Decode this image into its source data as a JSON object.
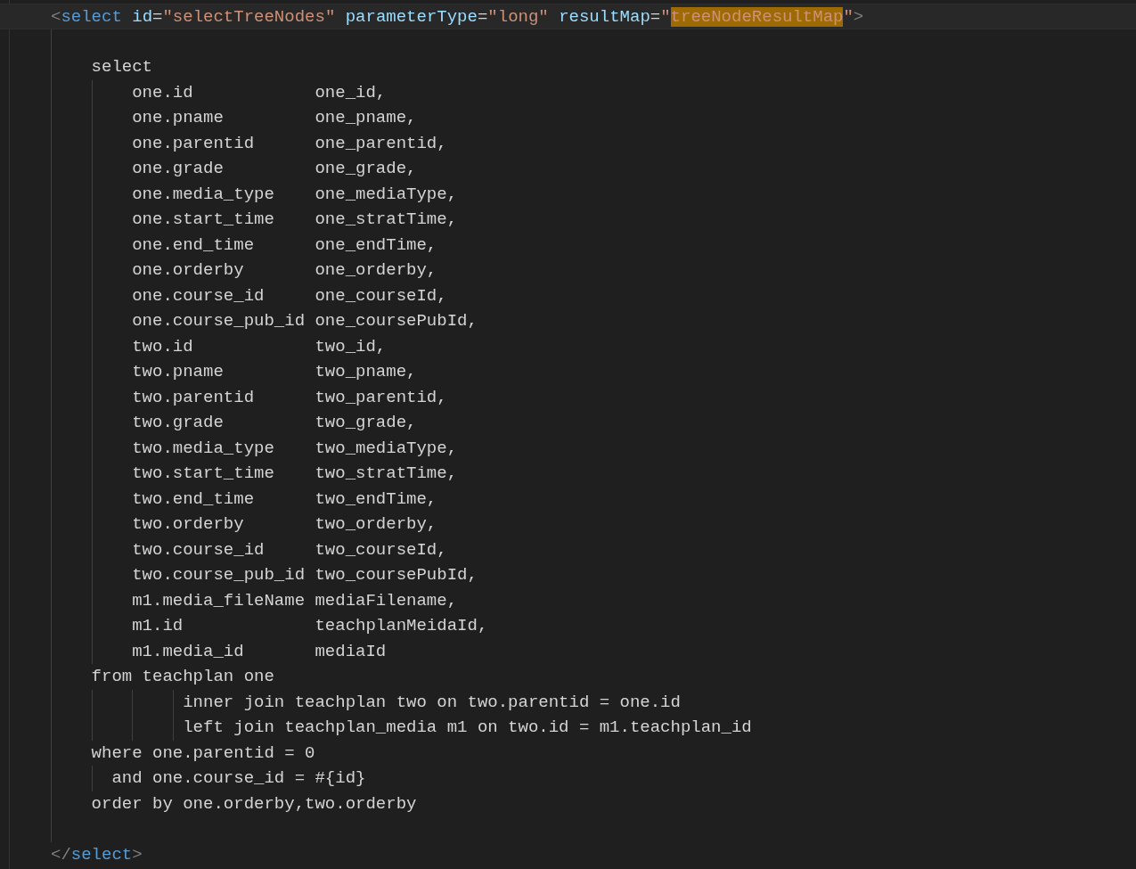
{
  "editor": {
    "lines": [
      {
        "kind": "code",
        "current": true,
        "tokens": [
          {
            "kind": "punct",
            "text": "    <"
          },
          {
            "kind": "tag",
            "text": "select"
          },
          {
            "kind": "attr",
            "text": " id"
          },
          {
            "kind": "plain",
            "text": "="
          },
          {
            "kind": "string",
            "text": "\"selectTreeNodes\""
          },
          {
            "kind": "attr",
            "text": " parameterType"
          },
          {
            "kind": "plain",
            "text": "="
          },
          {
            "kind": "string",
            "text": "\"long\""
          },
          {
            "kind": "attr",
            "text": " resultMap"
          },
          {
            "kind": "plain",
            "text": "="
          },
          {
            "kind": "string",
            "text": "\""
          },
          {
            "kind": "match",
            "text": "treeNodeResultMap"
          },
          {
            "kind": "string",
            "text": "\""
          },
          {
            "kind": "punct",
            "text": ">"
          }
        ]
      },
      {
        "kind": "blank",
        "current": false
      },
      {
        "kind": "code",
        "current": false,
        "tokens": [
          {
            "kind": "plain",
            "text": "        select"
          }
        ]
      },
      {
        "kind": "code",
        "current": false,
        "tokens": [
          {
            "kind": "plain",
            "text": "            one.id            one_id,"
          }
        ]
      },
      {
        "kind": "code",
        "current": false,
        "tokens": [
          {
            "kind": "plain",
            "text": "            one.pname         one_pname,"
          }
        ]
      },
      {
        "kind": "code",
        "current": false,
        "tokens": [
          {
            "kind": "plain",
            "text": "            one.parentid      one_parentid,"
          }
        ]
      },
      {
        "kind": "code",
        "current": false,
        "tokens": [
          {
            "kind": "plain",
            "text": "            one.grade         one_grade,"
          }
        ]
      },
      {
        "kind": "code",
        "current": false,
        "tokens": [
          {
            "kind": "plain",
            "text": "            one.media_type    one_mediaType,"
          }
        ]
      },
      {
        "kind": "code",
        "current": false,
        "tokens": [
          {
            "kind": "plain",
            "text": "            one.start_time    one_stratTime,"
          }
        ]
      },
      {
        "kind": "code",
        "current": false,
        "tokens": [
          {
            "kind": "plain",
            "text": "            one.end_time      one_endTime,"
          }
        ]
      },
      {
        "kind": "code",
        "current": false,
        "tokens": [
          {
            "kind": "plain",
            "text": "            one.orderby       one_orderby,"
          }
        ]
      },
      {
        "kind": "code",
        "current": false,
        "tokens": [
          {
            "kind": "plain",
            "text": "            one.course_id     one_courseId,"
          }
        ]
      },
      {
        "kind": "code",
        "current": false,
        "tokens": [
          {
            "kind": "plain",
            "text": "            one.course_pub_id one_coursePubId,"
          }
        ]
      },
      {
        "kind": "code",
        "current": false,
        "tokens": [
          {
            "kind": "plain",
            "text": "            two.id            two_id,"
          }
        ]
      },
      {
        "kind": "code",
        "current": false,
        "tokens": [
          {
            "kind": "plain",
            "text": "            two.pname         two_pname,"
          }
        ]
      },
      {
        "kind": "code",
        "current": false,
        "tokens": [
          {
            "kind": "plain",
            "text": "            two.parentid      two_parentid,"
          }
        ]
      },
      {
        "kind": "code",
        "current": false,
        "tokens": [
          {
            "kind": "plain",
            "text": "            two.grade         two_grade,"
          }
        ]
      },
      {
        "kind": "code",
        "current": false,
        "tokens": [
          {
            "kind": "plain",
            "text": "            two.media_type    two_mediaType,"
          }
        ]
      },
      {
        "kind": "code",
        "current": false,
        "tokens": [
          {
            "kind": "plain",
            "text": "            two.start_time    two_stratTime,"
          }
        ]
      },
      {
        "kind": "code",
        "current": false,
        "tokens": [
          {
            "kind": "plain",
            "text": "            two.end_time      two_endTime,"
          }
        ]
      },
      {
        "kind": "code",
        "current": false,
        "tokens": [
          {
            "kind": "plain",
            "text": "            two.orderby       two_orderby,"
          }
        ]
      },
      {
        "kind": "code",
        "current": false,
        "tokens": [
          {
            "kind": "plain",
            "text": "            two.course_id     two_courseId,"
          }
        ]
      },
      {
        "kind": "code",
        "current": false,
        "tokens": [
          {
            "kind": "plain",
            "text": "            two.course_pub_id two_coursePubId,"
          }
        ]
      },
      {
        "kind": "code",
        "current": false,
        "tokens": [
          {
            "kind": "plain",
            "text": "            m1.media_fileName mediaFilename,"
          }
        ]
      },
      {
        "kind": "code",
        "current": false,
        "tokens": [
          {
            "kind": "plain",
            "text": "            m1.id             teachplanMeidaId,"
          }
        ]
      },
      {
        "kind": "code",
        "current": false,
        "tokens": [
          {
            "kind": "plain",
            "text": "            m1.media_id       mediaId"
          }
        ]
      },
      {
        "kind": "code",
        "current": false,
        "tokens": [
          {
            "kind": "plain",
            "text": "        from teachplan one"
          }
        ]
      },
      {
        "kind": "code",
        "current": false,
        "tokens": [
          {
            "kind": "plain",
            "text": "                 inner join teachplan two on two.parentid = one.id"
          }
        ]
      },
      {
        "kind": "code",
        "current": false,
        "tokens": [
          {
            "kind": "plain",
            "text": "                 left join teachplan_media m1 on two.id = m1.teachplan_id"
          }
        ]
      },
      {
        "kind": "code",
        "current": false,
        "tokens": [
          {
            "kind": "plain",
            "text": "        where one.parentid = 0"
          }
        ]
      },
      {
        "kind": "code",
        "current": false,
        "tokens": [
          {
            "kind": "plain",
            "text": "          and one.course_id = #{id}"
          }
        ]
      },
      {
        "kind": "code",
        "current": false,
        "tokens": [
          {
            "kind": "plain",
            "text": "        order by one.orderby,two.orderby"
          }
        ]
      },
      {
        "kind": "blank",
        "current": false
      },
      {
        "kind": "code",
        "current": false,
        "tokens": [
          {
            "kind": "punct",
            "text": "    </"
          },
          {
            "kind": "tag",
            "text": "select"
          },
          {
            "kind": "punct",
            "text": ">"
          }
        ]
      }
    ]
  }
}
